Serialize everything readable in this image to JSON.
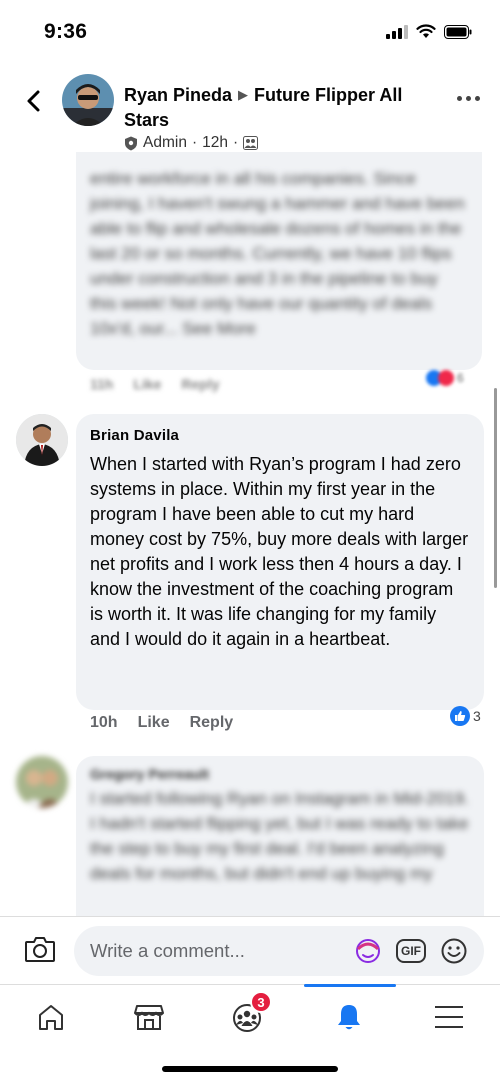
{
  "status_bar": {
    "time": "9:36"
  },
  "header": {
    "author": "Ryan Pineda",
    "group": "Future Flipper All Stars",
    "role": "Admin",
    "time": "12h",
    "separator": "·"
  },
  "previous_comment": {
    "text": "entire workforce in all his companies. Since joining, I haven't swung a hammer and have been able to flip and wholesale dozens of homes in the last 20 or so months. Currently, we have 10 flips under construction and 3 in the pipeline to buy this week! Not only have our quantity of deals 10x'd, our... See More",
    "time": "11h",
    "like_label": "Like",
    "reply_label": "Reply",
    "reaction_count": "6"
  },
  "comment": {
    "author": "Brian Davila",
    "text": "When I started with Ryan’s program I had zero systems in place. Within my first year in the program I have been able to cut my hard money cost by 75%, buy more deals with larger net profits and I work less then 4 hours a day. I know the investment of the coaching program is worth it. It was life changing for my family and I would do it again in a heartbeat.",
    "time": "10h",
    "like_label": "Like",
    "reply_label": "Reply",
    "reaction_count": "3"
  },
  "next_comment": {
    "author": "Gregory Perreault",
    "text": "I started following Ryan on Instagram in Mid-2019. I hadn't started flipping yet, but I was ready to take the step to buy my first deal. I'd been analyzing deals for months, but didn't end up buying my"
  },
  "composer": {
    "placeholder": "Write a comment...",
    "gif_label": "GIF"
  },
  "tabbar": {
    "groups_badge": "3",
    "active_tab": "notifications"
  },
  "colors": {
    "accent": "#1877f2",
    "badge": "#e41e3f",
    "bubble": "#f0f2f5"
  }
}
